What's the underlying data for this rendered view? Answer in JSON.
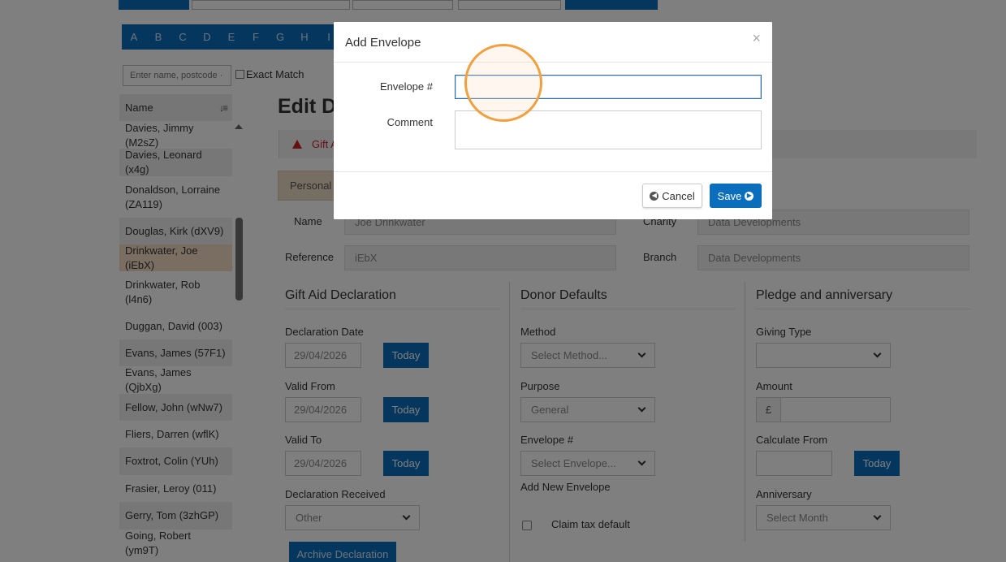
{
  "alphabet": [
    "A",
    "B",
    "C",
    "D",
    "E",
    "F",
    "G",
    "H",
    "I"
  ],
  "sidebar": {
    "search_placeholder": "Enter name, postcode ·",
    "exact_match_label": "Exact Match",
    "list_header": "Name",
    "donors": [
      {
        "label": "Davies, Jimmy (M2sZ)",
        "state": "normal"
      },
      {
        "label": "Davies, Leonard (x4g)",
        "state": "alt"
      },
      {
        "label": "Donaldson, Lorraine (ZA119)",
        "state": "normal"
      },
      {
        "label": "Douglas, Kirk (dXV9)",
        "state": "alt"
      },
      {
        "label": "Drinkwater, Joe (iEbX)",
        "state": "selected"
      },
      {
        "label": "Drinkwater, Rob (l4n6)",
        "state": "normal"
      },
      {
        "label": "Duggan, David (003)",
        "state": "normal"
      },
      {
        "label": "Evans, James (57F1)",
        "state": "alt"
      },
      {
        "label": "Evans, James (QjbXg)",
        "state": "normal"
      },
      {
        "label": "Fellow, John (wNw7)",
        "state": "alt"
      },
      {
        "label": "Fliers, Darren (wflK)",
        "state": "normal"
      },
      {
        "label": "Foxtrot, Colin (YUh)",
        "state": "alt"
      },
      {
        "label": "Frasier, Leroy (011)",
        "state": "normal"
      },
      {
        "label": "Gerry, Tom (3zhGP)",
        "state": "alt"
      },
      {
        "label": "Going, Robert (ym9T)",
        "state": "normal"
      }
    ]
  },
  "main": {
    "title": "Edit D",
    "alert_text": "Gift A",
    "tab_personal": "Personal",
    "name_label": "Name",
    "name_value": "Joe Drinkwater",
    "reference_label": "Reference",
    "reference_value": "iEbX",
    "charity_label": "Charity",
    "charity_value": "Data Developments",
    "branch_label": "Branch",
    "branch_value": "Data Developments",
    "gift_aid": {
      "title": "Gift Aid Declaration",
      "declaration_date_label": "Declaration Date",
      "declaration_date": "29/04/2026",
      "valid_from_label": "Valid From",
      "valid_from": "29/04/2026",
      "valid_to_label": "Valid To",
      "valid_to": "29/04/2026",
      "today_label": "Today",
      "received_label": "Declaration Received",
      "received_value": "Other",
      "archive_label": "Archive Declaration"
    },
    "donor_defaults": {
      "title": "Donor Defaults",
      "method_label": "Method",
      "method_value": "Select Method...",
      "purpose_label": "Purpose",
      "purpose_value": "General",
      "envelope_label": "Envelope #",
      "envelope_value": "Select Envelope...",
      "add_envelope_link": "Add New Envelope",
      "claim_tax_label": "Claim tax default"
    },
    "pledge": {
      "title": "Pledge and anniversary",
      "giving_type_label": "Giving Type",
      "giving_type_value": "",
      "amount_label": "Amount",
      "currency_symbol": "£",
      "calculate_from_label": "Calculate From",
      "calculate_from_value": "",
      "today_label": "Today",
      "anniversary_label": "Anniversary",
      "anniversary_value": "Select Month"
    }
  },
  "modal": {
    "title": "Add Envelope",
    "close_symbol": "×",
    "envelope_label": "Envelope #",
    "envelope_value": "",
    "comment_label": "Comment",
    "comment_value": "",
    "cancel_label": "Cancel",
    "save_label": "Save"
  },
  "colors": {
    "primary_blue": "#0a6ebd",
    "selected_row": "#f4ddc4",
    "alert_red": "#cc2222",
    "click_highlight": "#f0a040"
  }
}
